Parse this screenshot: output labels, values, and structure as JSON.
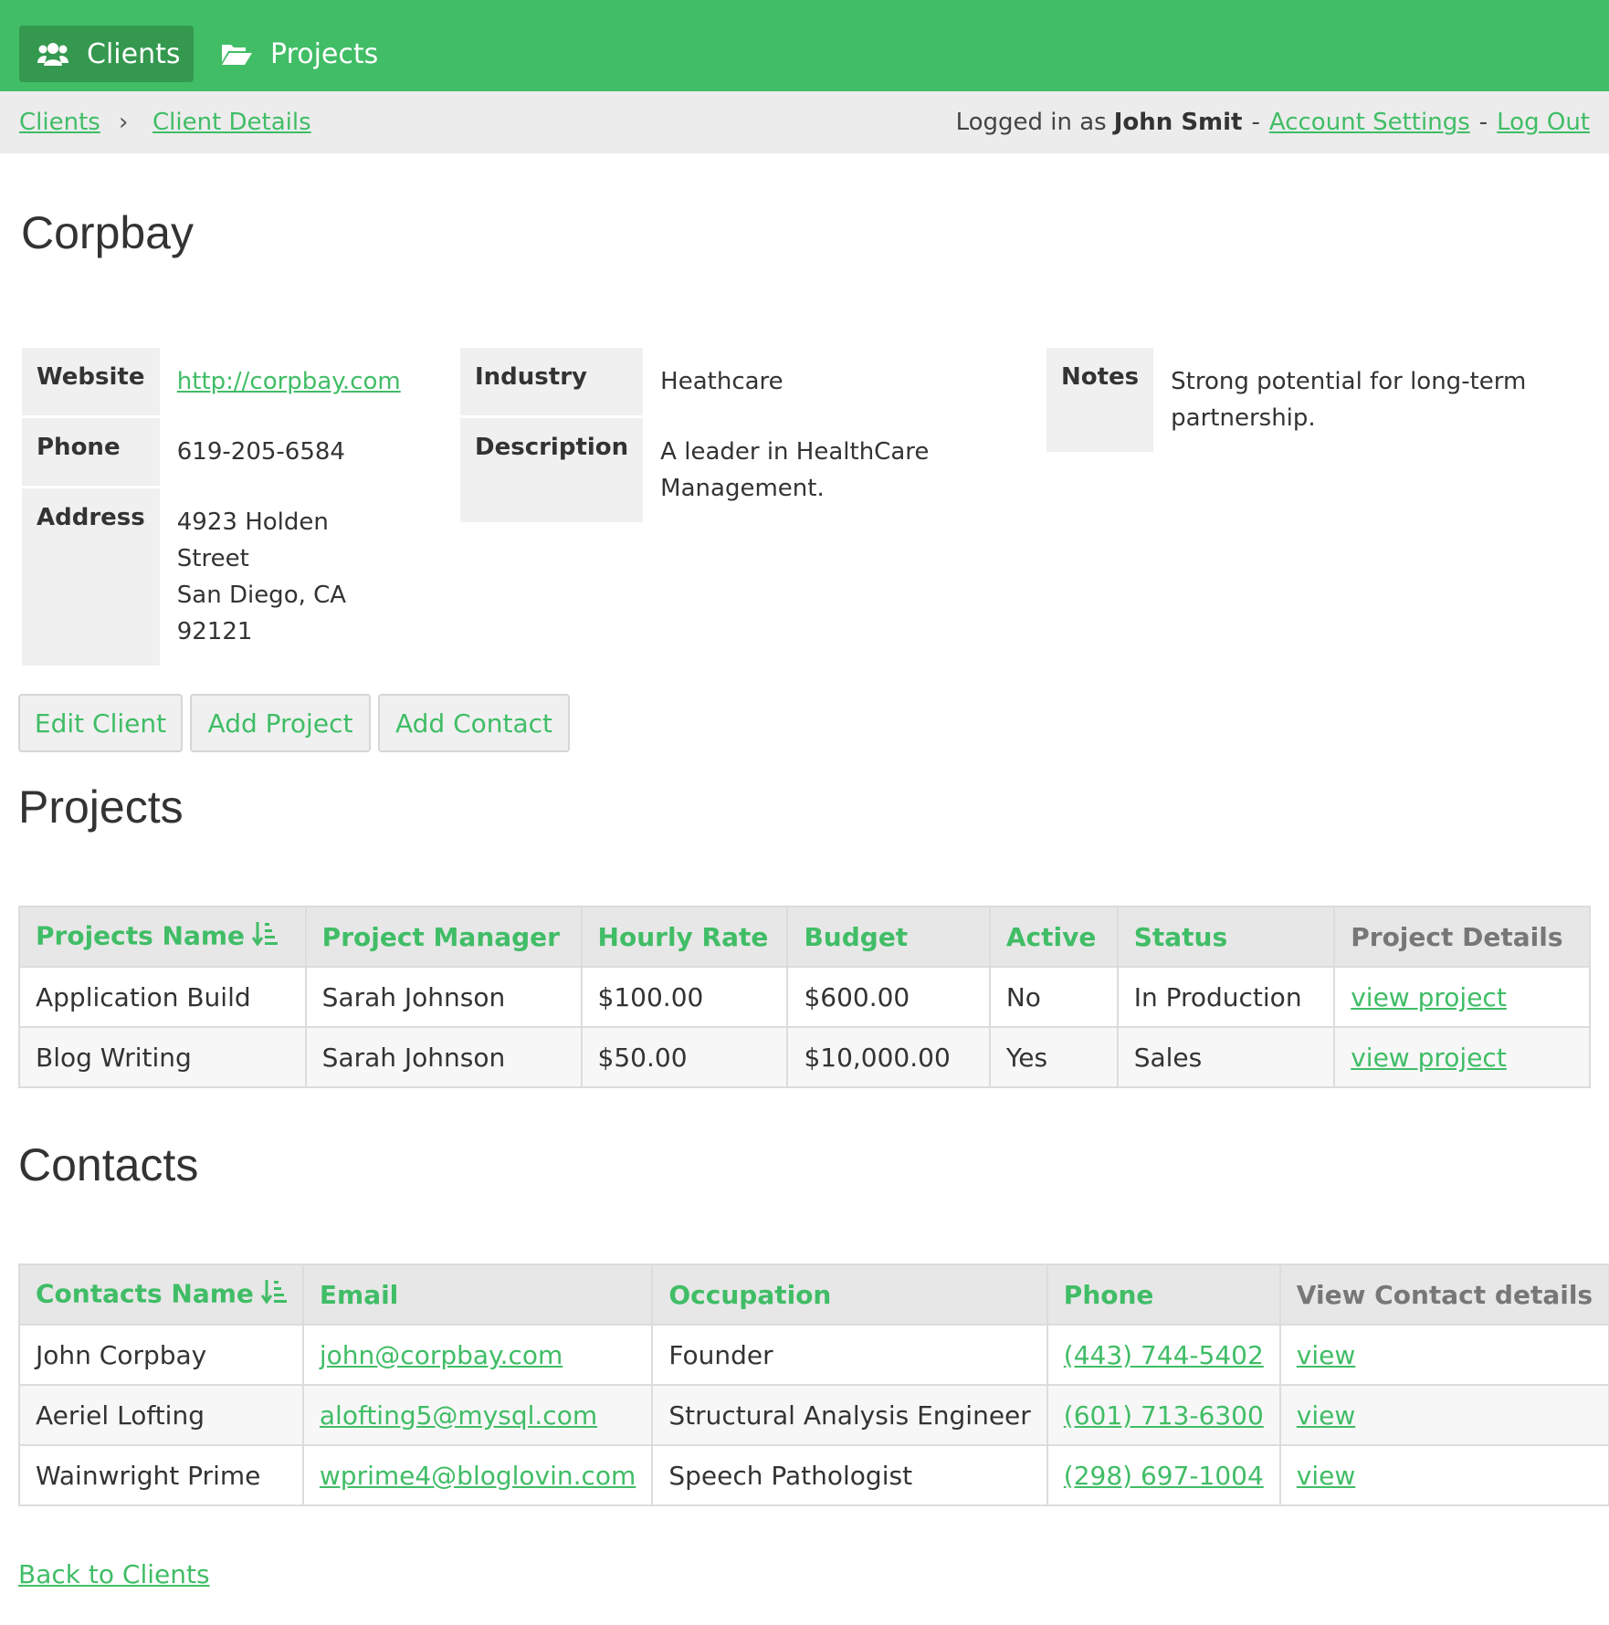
{
  "nav": {
    "clients": "Clients",
    "projects": "Projects"
  },
  "breadcrumb": {
    "clients": "Clients",
    "separator": "›",
    "details": "Client Details"
  },
  "user": {
    "prefix": "Logged in as",
    "name": "John Smit",
    "dash": "-",
    "settings": "Account Settings",
    "logout": "Log Out"
  },
  "client": {
    "name": "Corpbay",
    "website_label": "Website",
    "website": "http://corpbay.com",
    "phone_label": "Phone",
    "phone": "619-205-6584",
    "address_label": "Address",
    "address_line1": "4923 Holden Street",
    "address_line2": "San Diego, CA 92121",
    "industry_label": "Industry",
    "industry": "Heathcare",
    "description_label": "Description",
    "description": "A leader in HealthCare Management.",
    "notes_label": "Notes",
    "notes": "Strong potential for long-term partnership."
  },
  "actions": {
    "edit": "Edit Client",
    "add_project": "Add Project",
    "add_contact": "Add Contact"
  },
  "projects": {
    "heading": "Projects",
    "columns": [
      "Projects Name",
      "Project Manager",
      "Hourly Rate",
      "Budget",
      "Active",
      "Status",
      "Project Details"
    ],
    "rows": [
      [
        "Application Build",
        "Sarah Johnson",
        "$100.00",
        "$600.00",
        "No",
        "In Production",
        "view project"
      ],
      [
        "Blog Writing",
        "Sarah Johnson",
        "$50.00",
        "$10,000.00",
        "Yes",
        "Sales",
        "view project"
      ]
    ]
  },
  "contacts": {
    "heading": "Contacts",
    "columns": [
      "Contacts Name",
      "Email",
      "Occupation",
      "Phone",
      "View Contact details"
    ],
    "rows": [
      [
        "John Corpbay",
        "john@corpbay.com",
        "Founder",
        "(443) 744-5402",
        "view"
      ],
      [
        "Aeriel Lofting",
        "alofting5@mysql.com",
        "Structural Analysis Engineer",
        "(601) 713-6300",
        "view"
      ],
      [
        "Wainwright Prime",
        "wprime4@bloglovin.com",
        "Speech Pathologist",
        "(298) 697-1004",
        "view"
      ]
    ]
  },
  "footer": {
    "back": "Back to Clients"
  },
  "icons": {
    "clients": "users-icon",
    "projects": "folder-open-icon",
    "sort": "sort-amount-asc-icon"
  },
  "colors": {
    "brand": "#41bd66",
    "brand_dark": "#34984f",
    "link": "#40bd66"
  }
}
